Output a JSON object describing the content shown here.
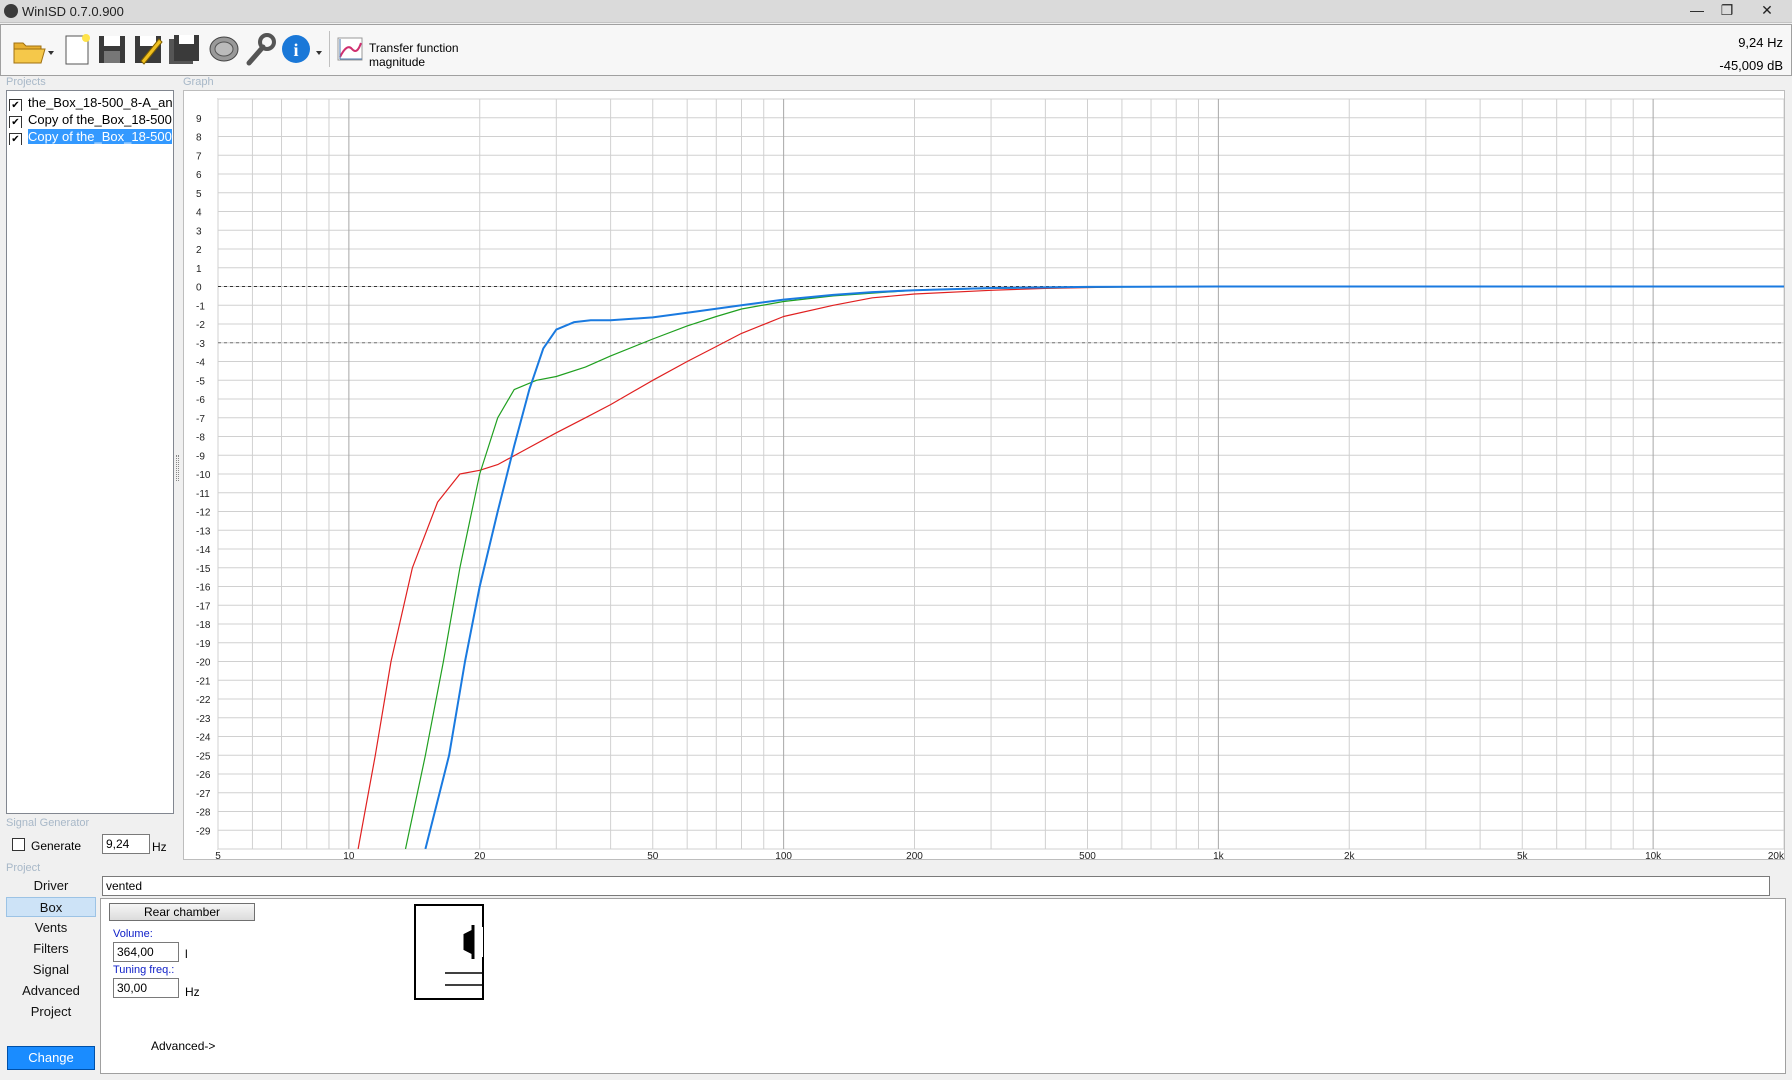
{
  "window": {
    "title": "WinISD 0.7.0.900"
  },
  "toolbar": {
    "graph_type_label": "Transfer function magnitude",
    "cursor_freq": "9,24 Hz",
    "cursor_level": "-45,009 dB"
  },
  "sections": {
    "projects": "Projects",
    "graph": "Graph",
    "signal_generator": "Signal Generator",
    "project": "Project"
  },
  "projects": [
    {
      "label": "the_Box_18-500_8-A_an",
      "checked": true,
      "selected": false
    },
    {
      "label": "Copy of the_Box_18-500",
      "checked": true,
      "selected": false
    },
    {
      "label": "Copy of the_Box_18-500",
      "checked": true,
      "selected": true
    }
  ],
  "signal_generator": {
    "generate_label": "Generate",
    "generate_checked": false,
    "frequency": "9,24",
    "unit": "Hz"
  },
  "nav": {
    "items": [
      "Driver",
      "Box",
      "Vents",
      "Filters",
      "Signal",
      "Advanced",
      "Project"
    ],
    "active": "Box",
    "change_label": "Change"
  },
  "box_panel": {
    "type": "vented",
    "rear_chamber_button": "Rear chamber",
    "volume_label": "Volume:",
    "volume_value": "364,00",
    "volume_unit": "l",
    "tuning_label": "Tuning freq.:",
    "tuning_value": "30,00",
    "tuning_unit": "Hz",
    "advanced_link": "Advanced->"
  },
  "chart_data": {
    "type": "line",
    "title": "",
    "xlabel": "",
    "ylabel": "",
    "x_scale": "log",
    "xlim": [
      5,
      20000
    ],
    "ylim": [
      -30,
      10
    ],
    "x_tick_labels": [
      {
        "value": 5,
        "label": "5"
      },
      {
        "value": 10,
        "label": "10"
      },
      {
        "value": 20,
        "label": "20"
      },
      {
        "value": 50,
        "label": "50"
      },
      {
        "value": 100,
        "label": "100"
      },
      {
        "value": 200,
        "label": "200"
      },
      {
        "value": 500,
        "label": "500"
      },
      {
        "value": 1000,
        "label": "1k"
      },
      {
        "value": 2000,
        "label": "2k"
      },
      {
        "value": 5000,
        "label": "5k"
      },
      {
        "value": 10000,
        "label": "10k"
      },
      {
        "value": 20000,
        "label": "20k"
      }
    ],
    "y_ticks": [
      9,
      8,
      7,
      6,
      5,
      4,
      3,
      2,
      1,
      0,
      -1,
      -2,
      -3,
      -4,
      -5,
      -6,
      -7,
      -8,
      -9,
      -10,
      -11,
      -12,
      -13,
      -14,
      -15,
      -16,
      -17,
      -18,
      -19,
      -20,
      -21,
      -22,
      -23,
      -24,
      -25,
      -26,
      -27,
      -28,
      -29
    ],
    "reference_lines": [
      {
        "y": 0,
        "style": "dotted"
      },
      {
        "y": -3,
        "style": "dotted"
      }
    ],
    "grid": true,
    "series": [
      {
        "color": "#e02020",
        "points": [
          [
            10.5,
            -30
          ],
          [
            11.5,
            -25
          ],
          [
            12.5,
            -20
          ],
          [
            14,
            -15
          ],
          [
            16,
            -11.5
          ],
          [
            18,
            -10
          ],
          [
            20,
            -9.8
          ],
          [
            22,
            -9.5
          ],
          [
            25,
            -8.8
          ],
          [
            30,
            -7.8
          ],
          [
            35,
            -7
          ],
          [
            40,
            -6.3
          ],
          [
            50,
            -5
          ],
          [
            60,
            -4
          ],
          [
            70,
            -3.2
          ],
          [
            80,
            -2.5
          ],
          [
            100,
            -1.6
          ],
          [
            130,
            -1
          ],
          [
            160,
            -0.6
          ],
          [
            200,
            -0.4
          ],
          [
            300,
            -0.2
          ],
          [
            400,
            -0.1
          ],
          [
            600,
            -0.02
          ],
          [
            1000,
            0
          ],
          [
            20000,
            0
          ]
        ]
      },
      {
        "color": "#20a020",
        "points": [
          [
            13.5,
            -30
          ],
          [
            15,
            -25
          ],
          [
            16.5,
            -20
          ],
          [
            18,
            -15
          ],
          [
            20,
            -10
          ],
          [
            22,
            -7
          ],
          [
            24,
            -5.5
          ],
          [
            27,
            -5
          ],
          [
            30,
            -4.8
          ],
          [
            35,
            -4.3
          ],
          [
            40,
            -3.7
          ],
          [
            50,
            -2.8
          ],
          [
            60,
            -2.1
          ],
          [
            70,
            -1.6
          ],
          [
            80,
            -1.2
          ],
          [
            100,
            -0.8
          ],
          [
            130,
            -0.5
          ],
          [
            160,
            -0.35
          ],
          [
            200,
            -0.2
          ],
          [
            300,
            -0.1
          ],
          [
            500,
            -0.03
          ],
          [
            1000,
            0
          ],
          [
            20000,
            0
          ]
        ]
      },
      {
        "color": "#1a7ae0",
        "points": [
          [
            15,
            -30
          ],
          [
            17,
            -25
          ],
          [
            18.5,
            -20
          ],
          [
            20,
            -16
          ],
          [
            22,
            -12
          ],
          [
            24,
            -8.5
          ],
          [
            26,
            -5.5
          ],
          [
            28,
            -3.3
          ],
          [
            30,
            -2.3
          ],
          [
            33,
            -1.9
          ],
          [
            36,
            -1.8
          ],
          [
            40,
            -1.8
          ],
          [
            50,
            -1.65
          ],
          [
            60,
            -1.4
          ],
          [
            80,
            -1
          ],
          [
            100,
            -0.7
          ],
          [
            130,
            -0.45
          ],
          [
            160,
            -0.3
          ],
          [
            200,
            -0.2
          ],
          [
            300,
            -0.08
          ],
          [
            500,
            -0.02
          ],
          [
            1000,
            0
          ],
          [
            20000,
            0
          ]
        ]
      }
    ]
  }
}
